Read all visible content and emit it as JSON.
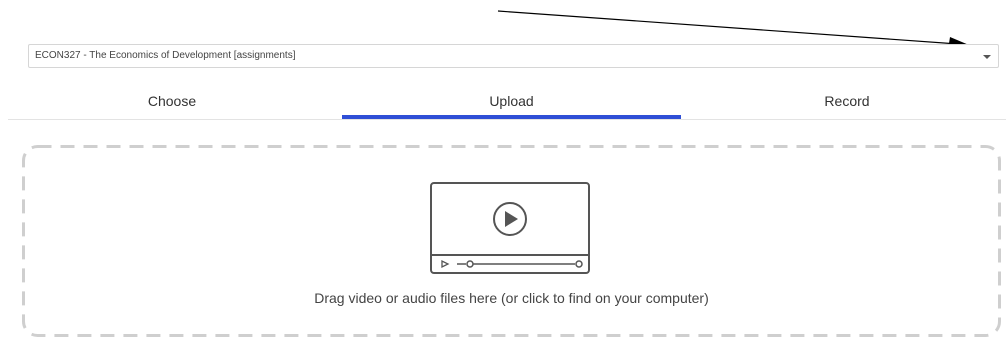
{
  "course_select": {
    "selected": "ECON327 - The Economics of Development [assignments]",
    "caret_icon": "caret-down-icon"
  },
  "tabs": [
    {
      "label": "Choose",
      "active": false
    },
    {
      "label": "Upload",
      "active": true
    },
    {
      "label": "Record",
      "active": false
    }
  ],
  "dropzone": {
    "icon": "video-player-icon",
    "text": "Drag video or audio files here (or click to find on your computer)"
  },
  "colors": {
    "active_tab": "#2f4fd6",
    "dashed_border": "#cfcfcf",
    "icon_stroke": "#555555",
    "annotation_arrow": "#000000"
  }
}
